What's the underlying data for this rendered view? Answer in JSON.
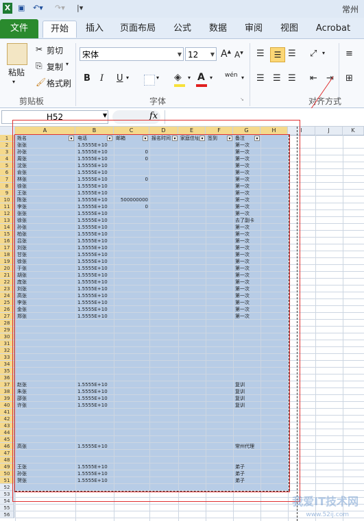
{
  "title_bar": {
    "title": "常州"
  },
  "quick_access": {
    "save": "save-icon",
    "undo": "undo-icon",
    "redo": "redo-icon"
  },
  "tabs": [
    {
      "label": "文件"
    },
    {
      "label": "开始"
    },
    {
      "label": "插入"
    },
    {
      "label": "页面布局"
    },
    {
      "label": "公式"
    },
    {
      "label": "数据"
    },
    {
      "label": "审阅"
    },
    {
      "label": "视图"
    },
    {
      "label": "Acrobat"
    }
  ],
  "ribbon": {
    "clipboard": {
      "paste": "粘贴",
      "cut": "剪切",
      "copy": "复制",
      "format_painter": "格式刷",
      "group": "剪贴板"
    },
    "font": {
      "name": "宋体",
      "size": "12",
      "bold": "B",
      "italic": "I",
      "underline": "U",
      "group": "字体",
      "wen": "wén"
    },
    "alignment": {
      "group": "对齐方式"
    }
  },
  "formula_bar": {
    "name_box": "H52",
    "fx": "fx"
  },
  "columns": [
    "A",
    "B",
    "C",
    "D",
    "E",
    "F",
    "G",
    "H",
    "I",
    "J",
    "K"
  ],
  "header_row": [
    "姓名",
    "电话",
    "邮箱",
    "报名时间",
    "家庭住址",
    "签到",
    "备注"
  ],
  "rows": [
    {
      "n": "2",
      "a": "张张",
      "b": "1.5555E+10",
      "c": "",
      "g": "第一次"
    },
    {
      "n": "3",
      "a": "孙张",
      "b": "1.5555E+10",
      "c": "0",
      "g": "第一次"
    },
    {
      "n": "4",
      "a": "周张",
      "b": "1.5555E+10",
      "c": "0",
      "g": "第一次"
    },
    {
      "n": "5",
      "a": "沈张",
      "b": "1.5555E+10",
      "c": "",
      "g": "第一次"
    },
    {
      "n": "6",
      "a": "俞张",
      "b": "1.5555E+10",
      "c": "",
      "g": "第一次"
    },
    {
      "n": "7",
      "a": "林张",
      "b": "1.5555E+10",
      "c": "0",
      "g": "第一次"
    },
    {
      "n": "8",
      "a": "徐张",
      "b": "1.5555E+10",
      "c": "",
      "g": "第一次"
    },
    {
      "n": "9",
      "a": "王张",
      "b": "1.5555E+10",
      "c": "",
      "g": "第一次"
    },
    {
      "n": "10",
      "a": "陈张",
      "b": "1.5555E+10",
      "c": "500000000",
      "g": "第一次"
    },
    {
      "n": "11",
      "a": "李张",
      "b": "1.5555E+10",
      "c": "0",
      "g": "第一次"
    },
    {
      "n": "12",
      "a": "张张",
      "b": "1.5555E+10",
      "c": "",
      "g": "第一次"
    },
    {
      "n": "13",
      "a": "徐张",
      "b": "1.5555E+10",
      "c": "",
      "g": "去了副卡"
    },
    {
      "n": "14",
      "a": "孙张",
      "b": "1.5555E+10",
      "c": "",
      "g": "第一次"
    },
    {
      "n": "15",
      "a": "柏张",
      "b": "1.5555E+10",
      "c": "",
      "g": "第一次"
    },
    {
      "n": "16",
      "a": "吕张",
      "b": "1.5555E+10",
      "c": "",
      "g": "第一次"
    },
    {
      "n": "17",
      "a": "刘张",
      "b": "1.5555E+10",
      "c": "",
      "g": "第一次"
    },
    {
      "n": "18",
      "a": "甘张",
      "b": "1.5555E+10",
      "c": "",
      "g": "第一次"
    },
    {
      "n": "19",
      "a": "徐张",
      "b": "1.5555E+10",
      "c": "",
      "g": "第一次"
    },
    {
      "n": "20",
      "a": "于张",
      "b": "1.5555E+10",
      "c": "",
      "g": "第一次"
    },
    {
      "n": "21",
      "a": "胡张",
      "b": "1.5555E+10",
      "c": "",
      "g": "第一次"
    },
    {
      "n": "22",
      "a": "庞张",
      "b": "1.5555E+10",
      "c": "",
      "g": "第一次"
    },
    {
      "n": "23",
      "a": "刘张",
      "b": "1.5555E+10",
      "c": "",
      "g": "第一次"
    },
    {
      "n": "24",
      "a": "高张",
      "b": "1.5555E+10",
      "c": "",
      "g": "第一次"
    },
    {
      "n": "25",
      "a": "李张",
      "b": "1.5555E+10",
      "c": "",
      "g": "第一次"
    },
    {
      "n": "26",
      "a": "金张",
      "b": "1.5555E+10",
      "c": "",
      "g": "第一次"
    },
    {
      "n": "27",
      "a": "郑张",
      "b": "1.5555E+10",
      "c": "",
      "g": "第一次"
    },
    {
      "n": "28"
    },
    {
      "n": "29"
    },
    {
      "n": "30"
    },
    {
      "n": "31"
    },
    {
      "n": "32"
    },
    {
      "n": "33"
    },
    {
      "n": "34"
    },
    {
      "n": "35"
    },
    {
      "n": "36"
    },
    {
      "n": "37",
      "a": "赵张",
      "b": "1.5555E+10",
      "c": "",
      "g": "复训"
    },
    {
      "n": "38",
      "a": "朱张",
      "b": "1.5555E+10",
      "c": "",
      "g": "复训"
    },
    {
      "n": "39",
      "a": "邵张",
      "b": "1.5555E+10",
      "c": "",
      "g": "复训"
    },
    {
      "n": "40",
      "a": "许张",
      "b": "1.5555E+10",
      "c": "",
      "g": "复训"
    },
    {
      "n": "41"
    },
    {
      "n": "42"
    },
    {
      "n": "43"
    },
    {
      "n": "44"
    },
    {
      "n": "45"
    },
    {
      "n": "46",
      "a": "高张",
      "b": "1.5555E+10",
      "c": "",
      "g": "常州代理"
    },
    {
      "n": "47"
    },
    {
      "n": "48"
    },
    {
      "n": "49",
      "a": "王张",
      "b": "1.5555E+10",
      "c": "",
      "g": "弟子"
    },
    {
      "n": "50",
      "a": "孙张",
      "b": "1.5555E+10",
      "c": "",
      "g": "弟子"
    },
    {
      "n": "51",
      "a": "贺张",
      "b": "1.5555E+10",
      "c": "",
      "g": "弟子"
    },
    {
      "n": "52"
    },
    {
      "n": "53"
    },
    {
      "n": "54"
    },
    {
      "n": "55"
    },
    {
      "n": "56"
    }
  ],
  "first_row_num": "1",
  "watermark": {
    "text": "我爱IT技术网",
    "url": "www.52ij.com"
  }
}
